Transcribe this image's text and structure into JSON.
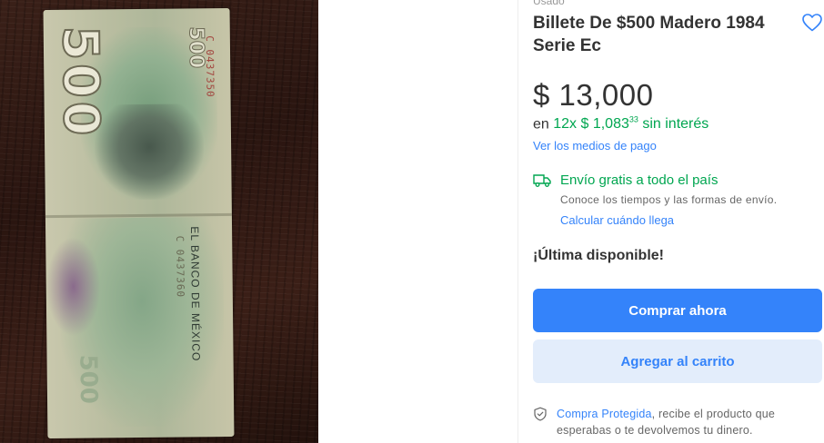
{
  "product": {
    "condition": "Usado",
    "title": "Billete De $500 Madero 1984 Serie Ec",
    "price": "$ 13,000",
    "installments": {
      "prefix": "en",
      "amount": "12x $ 1,083",
      "cents": "33",
      "suffix": "sin interés"
    },
    "payment_link": "Ver los medios de pago"
  },
  "shipping": {
    "icon": "truck-icon",
    "title": "Envío gratis a todo el país",
    "subtitle": "Conoce los tiempos y las formas de envío.",
    "link": "Calcular cuándo llega"
  },
  "stock": "¡Última disponible!",
  "actions": {
    "buy": "Comprar ahora",
    "cart": "Agregar al carrito"
  },
  "protection": {
    "icon": "shield-check-icon",
    "link": "Compra Protegida",
    "text": ", recibe el producto que esperabas o te devolvemos tu dinero."
  },
  "photo": {
    "denomination": "500",
    "bank_text": "EL BANCO DE MÉXICO",
    "serial": "C 0437350",
    "serial_2": "C 0437360"
  },
  "colors": {
    "accent": "#3483fa",
    "success": "#00a650",
    "secondary_button_bg": "#e3edfb"
  }
}
